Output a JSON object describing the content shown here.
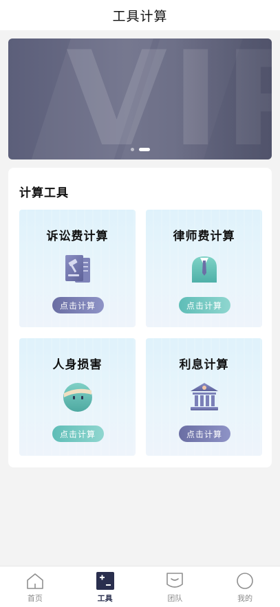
{
  "header": {
    "title": "工具计算"
  },
  "banner": {
    "text": "VIP"
  },
  "panel": {
    "title": "计算工具"
  },
  "cards": [
    {
      "title": "诉讼费计算",
      "button": "点击计算",
      "icon": "gavel-document-icon"
    },
    {
      "title": "律师费计算",
      "button": "点击计算",
      "icon": "lawyer-suit-icon"
    },
    {
      "title": "人身损害",
      "button": "点击计算",
      "icon": "bandaged-face-icon"
    },
    {
      "title": "利息计算",
      "button": "点击计算",
      "icon": "bank-building-icon"
    }
  ],
  "tabbar": {
    "items": [
      {
        "label": "首页",
        "icon": "home-icon",
        "active": false
      },
      {
        "label": "工具",
        "icon": "calculator-icon",
        "active": true
      },
      {
        "label": "团队",
        "icon": "team-shield-icon",
        "active": false
      },
      {
        "label": "我的",
        "icon": "profile-circle-icon",
        "active": false
      }
    ]
  },
  "colors": {
    "accent_dark": "#2a2f4e",
    "button_blue": "#6a6ea3",
    "button_green": "#5fbdb7",
    "banner": "#5c5f7a"
  }
}
